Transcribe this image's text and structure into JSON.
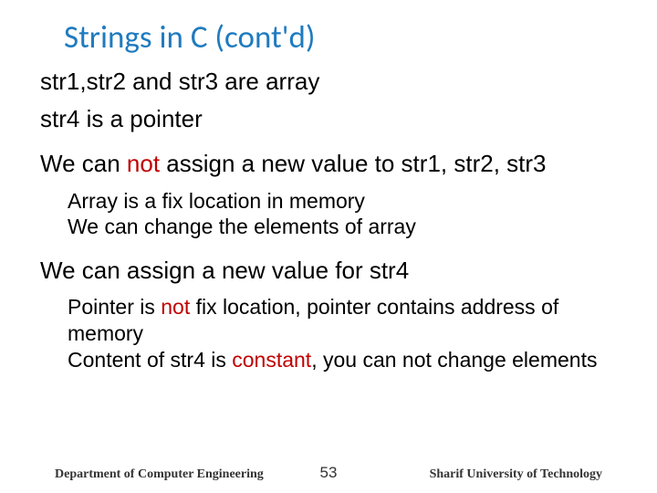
{
  "title": "Strings in C (cont'd)",
  "bullets": {
    "l1": "str1,str2 and str3 are array",
    "l2": "str4 is a pointer",
    "l3_a": "We can ",
    "l3_red": "not",
    "l3_b": " assign a new value to str1, str2, str3",
    "l3s1": "Array is a fix location in memory",
    "l3s2": "We can change the elements of array",
    "l4": "We can assign a new value for str4",
    "l4s1_a": "Pointer is ",
    "l4s1_red": "not",
    "l4s1_b": " fix location, pointer contains address of memory",
    "l4s2_a": "Content of str4 is ",
    "l4s2_red": "constant",
    "l4s2_b": ", you can not change elements"
  },
  "footer": {
    "left": "Department of Computer Engineering",
    "page": "53",
    "right": "Sharif University of Technology"
  }
}
